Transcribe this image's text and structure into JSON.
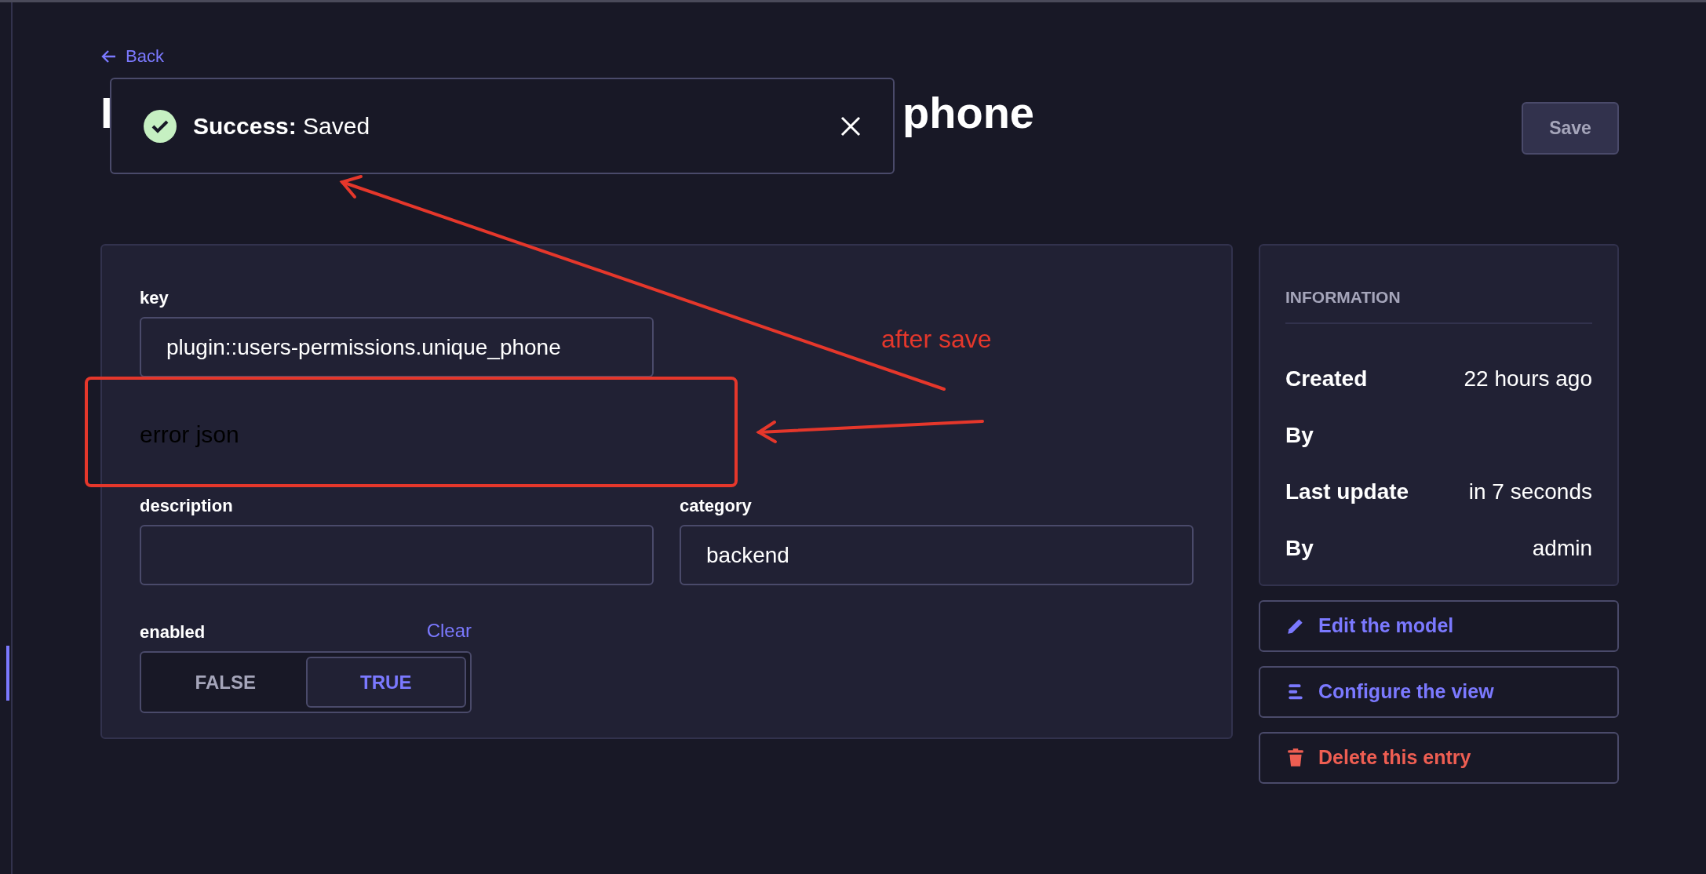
{
  "back_link": {
    "label": "Back"
  },
  "title_fragments": [
    "I",
    "phone"
  ],
  "save_button": {
    "label": "Save",
    "disabled": true
  },
  "toast": {
    "kind": "success",
    "title": "Success:",
    "message": "Saved"
  },
  "form": {
    "fields": [
      {
        "kind": "text",
        "label": "key",
        "value": "plugin::users-permissions.unique_phone"
      },
      {
        "kind": "note",
        "text": "error json"
      },
      {
        "kind": "text",
        "label": "description"
      },
      {
        "kind": "text",
        "label": "category",
        "value": "backend"
      },
      {
        "kind": "toggle",
        "label": "enabled",
        "clear": "Clear",
        "options": [
          {
            "label": "FALSE",
            "selected": false
          },
          {
            "label": "TRUE",
            "selected": true
          }
        ]
      }
    ]
  },
  "information": {
    "heading": "INFORMATION",
    "rows": [
      {
        "label": "Created",
        "value": "22 hours ago"
      },
      {
        "label": "By"
      },
      {
        "label": "Last update",
        "value": "in 7 seconds"
      },
      {
        "label": "By",
        "value": "admin"
      }
    ]
  },
  "actions": [
    {
      "kind": "edit",
      "label": "Edit the model"
    },
    {
      "kind": "configure",
      "label": "Configure the view"
    },
    {
      "kind": "delete",
      "label": "Delete this entry"
    }
  ],
  "annotation": {
    "text": "after save"
  }
}
